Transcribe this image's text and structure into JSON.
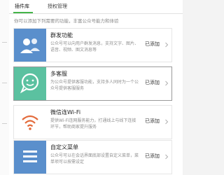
{
  "tabs": [
    {
      "label": "插件库"
    },
    {
      "label": "授权管理"
    }
  ],
  "description": "你可以添加下列需要的功能，丰富公众号能力和体验",
  "plugins": [
    {
      "title": "群发功能",
      "summary": "公众号可以向用户群发消息，支持文字、图片、语音、视频、图文消息等",
      "status": "已添加",
      "color": "#5a8fcc"
    },
    {
      "title": "多客服",
      "summary": "为公众号提供客服功能，支持多人同时为一个公众号提供客服服务",
      "status": "已添加",
      "color": "#5bc1a0"
    },
    {
      "title": "微信连Wi-Fi",
      "summary": "提供Wi-Fi连网服务能力，打通线上与线下连接环节，帮助商家提升服务",
      "status": "已添加",
      "color": "#ffffff"
    },
    {
      "title": "自定义菜单",
      "summary": "公众号可以在会话界面底部设置自定义菜单，菜单项可以按需设定",
      "status": "已添加",
      "color": "#5a8fcc"
    }
  ],
  "icons": [
    "users-icon",
    "chat-bubble-smile-icon",
    "wifi-icon",
    "menu-list-icon",
    "chevron-right-icon"
  ],
  "accent": "#44b549"
}
